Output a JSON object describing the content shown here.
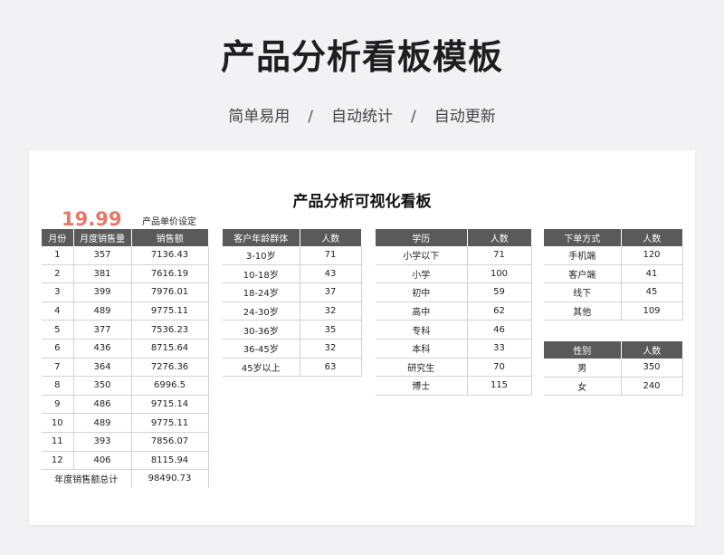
{
  "header": {
    "title": "产品分析看板模板",
    "taglines": [
      "简单易用",
      "自动统计",
      "自动更新"
    ],
    "separator": "/"
  },
  "board": {
    "title": "产品分析可视化看板",
    "unit_price": "19.99",
    "unit_price_label": "产品单价设定"
  },
  "colors": {
    "accent": "#e8776a",
    "header_bg": "#5a5a5a"
  },
  "sales": {
    "columns": [
      "月份",
      "月度销售量",
      "销售额"
    ],
    "rows": [
      [
        "1",
        "357",
        "7136.43"
      ],
      [
        "2",
        "381",
        "7616.19"
      ],
      [
        "3",
        "399",
        "7976.01"
      ],
      [
        "4",
        "489",
        "9775.11"
      ],
      [
        "5",
        "377",
        "7536.23"
      ],
      [
        "6",
        "436",
        "8715.64"
      ],
      [
        "7",
        "364",
        "7276.36"
      ],
      [
        "8",
        "350",
        "6996.5"
      ],
      [
        "9",
        "486",
        "9715.14"
      ],
      [
        "10",
        "489",
        "9775.11"
      ],
      [
        "11",
        "393",
        "7856.07"
      ],
      [
        "12",
        "406",
        "8115.94"
      ]
    ],
    "total_label": "年度销售额总计",
    "total_value": "98490.73"
  },
  "age": {
    "columns": [
      "客户年龄群体",
      "人数"
    ],
    "rows": [
      [
        "3-10岁",
        "71"
      ],
      [
        "10-18岁",
        "43"
      ],
      [
        "18-24岁",
        "37"
      ],
      [
        "24-30岁",
        "32"
      ],
      [
        "30-36岁",
        "35"
      ],
      [
        "36-45岁",
        "32"
      ],
      [
        "45岁以上",
        "63"
      ]
    ]
  },
  "education": {
    "columns": [
      "学历",
      "人数"
    ],
    "rows": [
      [
        "小学以下",
        "71"
      ],
      [
        "小学",
        "100"
      ],
      [
        "初中",
        "59"
      ],
      [
        "高中",
        "62"
      ],
      [
        "专科",
        "46"
      ],
      [
        "本科",
        "33"
      ],
      [
        "研究生",
        "70"
      ],
      [
        "博士",
        "115"
      ]
    ]
  },
  "order_method": {
    "columns": [
      "下单方式",
      "人数"
    ],
    "rows": [
      [
        "手机端",
        "120"
      ],
      [
        "客户端",
        "41"
      ],
      [
        "线下",
        "45"
      ],
      [
        "其他",
        "109"
      ]
    ]
  },
  "gender": {
    "columns": [
      "性别",
      "人数"
    ],
    "rows": [
      [
        "男",
        "350"
      ],
      [
        "女",
        "240"
      ]
    ]
  }
}
